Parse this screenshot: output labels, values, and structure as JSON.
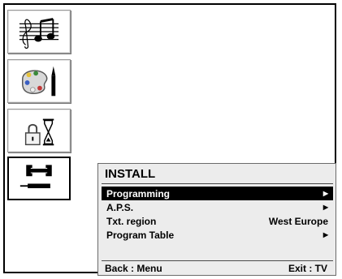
{
  "sidebar": {
    "items": [
      {
        "icon": "music-notes-icon"
      },
      {
        "icon": "palette-brush-icon"
      },
      {
        "icon": "lock-hourglass-icon"
      },
      {
        "icon": "wrench-screwdriver-icon",
        "selected": true
      }
    ]
  },
  "menu": {
    "title": "INSTALL",
    "rows": [
      {
        "label": "Programming",
        "arrow": "▶",
        "highlighted": true
      },
      {
        "label": "A.P.S.",
        "arrow": "▶"
      },
      {
        "label": "Txt. region",
        "value": "West Europe"
      },
      {
        "label": "Program Table",
        "arrow": "▶"
      }
    ],
    "footer": {
      "left": "Back : Menu",
      "right": "Exit : TV"
    }
  },
  "colors": {
    "highlight_bg": "#000000",
    "panel_bg": "#ececec",
    "highlight_text": "#ffffff"
  }
}
